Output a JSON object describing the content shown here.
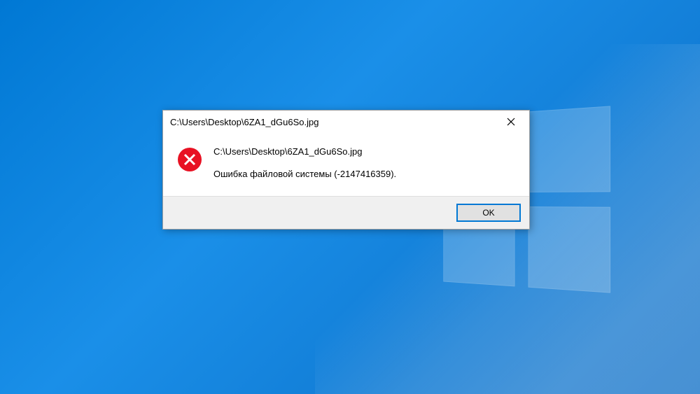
{
  "dialog": {
    "title": "C:\\Users\\Desktop\\6ZA1_dGu6So.jpg",
    "message_line1": "C:\\Users\\Desktop\\6ZA1_dGu6So.jpg",
    "message_line2": "Ошибка файловой системы (-2147416359).",
    "ok_label": "OK"
  }
}
